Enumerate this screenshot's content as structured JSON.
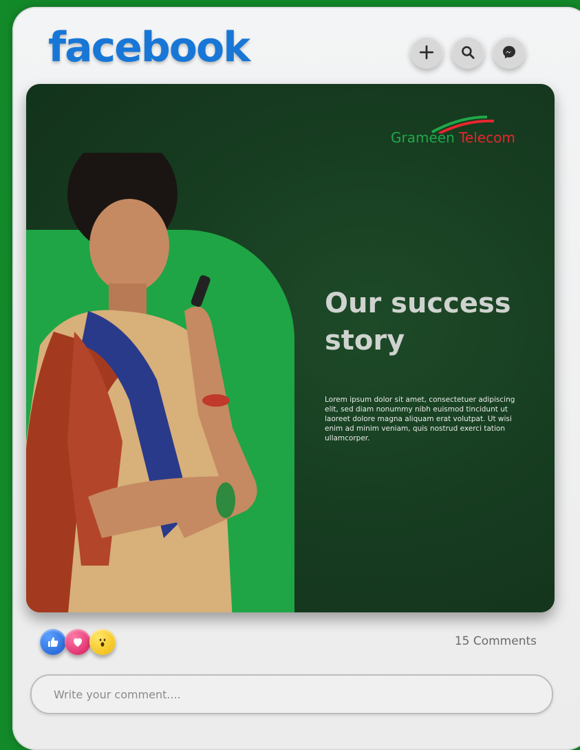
{
  "app": {
    "logo_text": "facebook",
    "brand_color": "#1877d6"
  },
  "header": {
    "actions": [
      {
        "icon": "plus-icon"
      },
      {
        "icon": "search-icon"
      },
      {
        "icon": "messenger-icon"
      }
    ]
  },
  "post": {
    "brand": {
      "part1": "Grameen",
      "part2": "Telecom"
    },
    "title": "Our success story",
    "body": "Lorem ipsum dolor sit amet, consectetuer adipiscing elit, sed diam nonummy nibh euismod tincidunt ut laoreet dolore magna aliquam erat volutpat. Ut wisi enim ad minim veniam, quis nostrud exerci tation ullamcorper.",
    "colors": {
      "background": "#173d21",
      "accent": "#1fa545"
    }
  },
  "reactions": [
    {
      "icon": "like-icon"
    },
    {
      "icon": "love-icon"
    },
    {
      "icon": "wow-icon"
    }
  ],
  "comments": {
    "count_label": "15 Comments",
    "placeholder": "Write your comment...."
  }
}
